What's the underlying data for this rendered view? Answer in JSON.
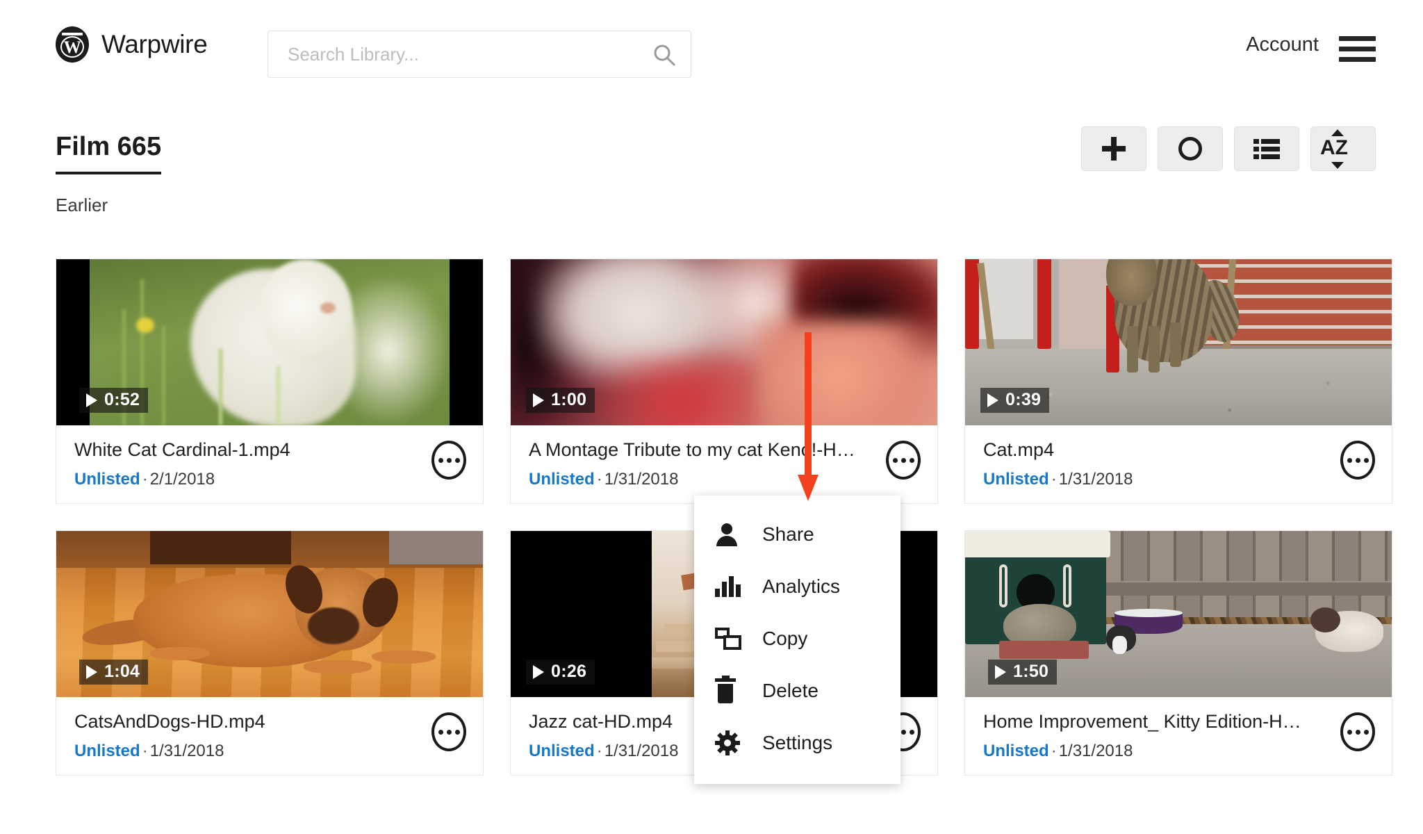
{
  "header": {
    "brand_name": "Warpwire",
    "logo_letter": "W",
    "search_placeholder": "Search Library...",
    "search_value": "",
    "account_label": "Account"
  },
  "title_row": {
    "page_title": "Film 665",
    "section_label": "Earlier",
    "toolbar": [
      {
        "name": "add",
        "glyph": "+"
      },
      {
        "name": "record",
        "glyph": "○"
      },
      {
        "name": "list-view",
        "glyph": "☰"
      },
      {
        "name": "sort-az",
        "glyph": "AZ"
      }
    ],
    "sort_letters": "AZ"
  },
  "media": [
    {
      "title": "White Cat Cardinal-1.mp4",
      "visibility": "Unlisted",
      "separator": "·",
      "date": "2/1/2018",
      "duration": "0:52",
      "scene": "whitecat"
    },
    {
      "title": "A Montage Tribute to my cat Keno!-H…",
      "visibility": "Unlisted",
      "separator": "·",
      "date": "1/31/2018",
      "duration": "1:00",
      "scene": "montage"
    },
    {
      "title": "Cat.mp4",
      "visibility": "Unlisted",
      "separator": "·",
      "date": "1/31/2018",
      "duration": "0:39",
      "scene": "tabby"
    },
    {
      "title": "CatsAndDogs-HD.mp4",
      "visibility": "Unlisted",
      "separator": "·",
      "date": "1/31/2018",
      "duration": "1:04",
      "scene": "dog"
    },
    {
      "title": "Jazz cat-HD.mp4",
      "visibility": "Unlisted",
      "separator": "·",
      "date": "1/31/2018",
      "duration": "0:26",
      "scene": "jazz"
    },
    {
      "title": "Home Improvement_ Kitty Edition-H…",
      "visibility": "Unlisted",
      "separator": "·",
      "date": "1/31/2018",
      "duration": "1:50",
      "scene": "yard"
    }
  ],
  "context_menu": {
    "items": [
      {
        "label": "Share",
        "icon": "person-icon"
      },
      {
        "label": "Analytics",
        "icon": "bar-chart-icon"
      },
      {
        "label": "Copy",
        "icon": "copy-icon"
      },
      {
        "label": "Delete",
        "icon": "trash-icon"
      },
      {
        "label": "Settings",
        "icon": "gear-icon"
      }
    ]
  },
  "annotation": {
    "type": "arrow",
    "direction": "down",
    "color": "#f4411f"
  },
  "colors": {
    "link_blue": "#1878c8",
    "text_dark": "#1c1c1c",
    "annotation_red": "#f4411f",
    "toolbar_bg": "#ededed"
  }
}
